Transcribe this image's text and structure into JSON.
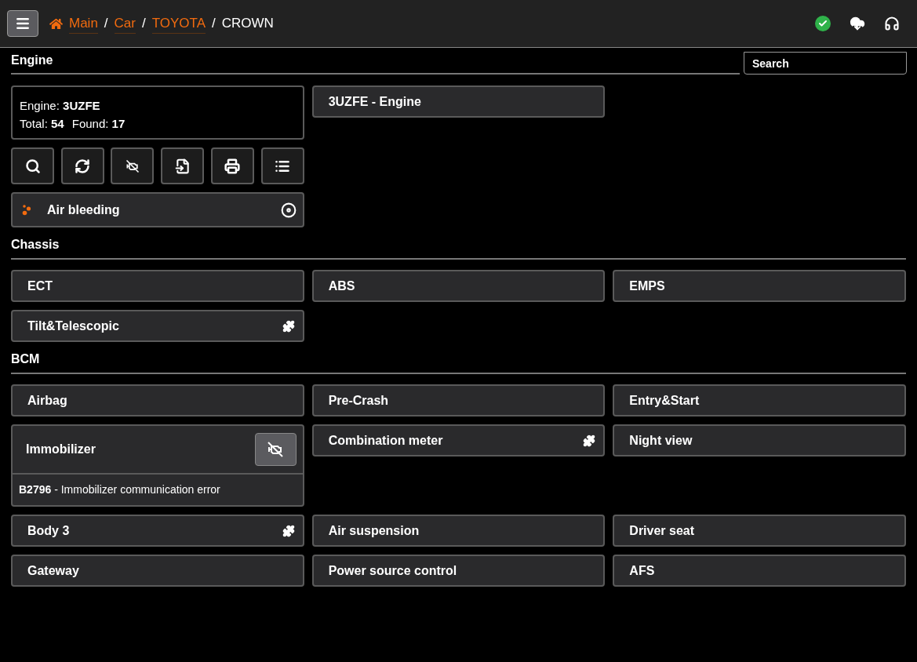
{
  "breadcrumb_separator": "/",
  "breadcrumb": [
    {
      "label": "Main",
      "kind": "home"
    },
    {
      "label": "Car",
      "kind": "link"
    },
    {
      "label": "TOYOTA",
      "kind": "link"
    },
    {
      "label": "CROWN",
      "kind": "current"
    }
  ],
  "search": {
    "placeholder": "Search"
  },
  "engine": {
    "title": "Engine",
    "info": [
      "Engine: **3UZFE**",
      "Total: **54**",
      "Found: **17**"
    ],
    "modules": [
      {
        "label": "3UZFE - Engine",
        "kind": "plain"
      }
    ],
    "functions": [
      {
        "label": "Air bleeding",
        "kind": "air-bleeding"
      }
    ]
  },
  "sections": [
    {
      "title": "Chassis",
      "modules": [
        {
          "label": "ECT",
          "kind": "plain"
        },
        {
          "label": "ABS",
          "kind": "plain"
        },
        {
          "label": "EMPS",
          "kind": "plain"
        },
        {
          "label": "Tilt&Telescopic",
          "kind": "plugin"
        }
      ]
    },
    {
      "title": "BCM",
      "modules": [
        {
          "label": "Airbag",
          "kind": "plain"
        },
        {
          "label": "Pre-Crash",
          "kind": "plain"
        },
        {
          "label": "Entry&Start",
          "kind": "plain"
        },
        {
          "label": "Immobilizer",
          "kind": "dtc",
          "dtc": "**B2796** - Immobilizer communication error"
        },
        {
          "label": "Combination meter",
          "kind": "plugin"
        },
        {
          "label": "Night view",
          "kind": "plain"
        },
        {
          "label": "Body 3",
          "kind": "plugin"
        },
        {
          "label": "Air suspension",
          "kind": "plain"
        },
        {
          "label": "Driver seat",
          "kind": "plain"
        },
        {
          "label": "Gateway",
          "kind": "plain"
        },
        {
          "label": "Power source control",
          "kind": "plain"
        },
        {
          "label": "AFS",
          "kind": "plain"
        }
      ]
    }
  ]
}
